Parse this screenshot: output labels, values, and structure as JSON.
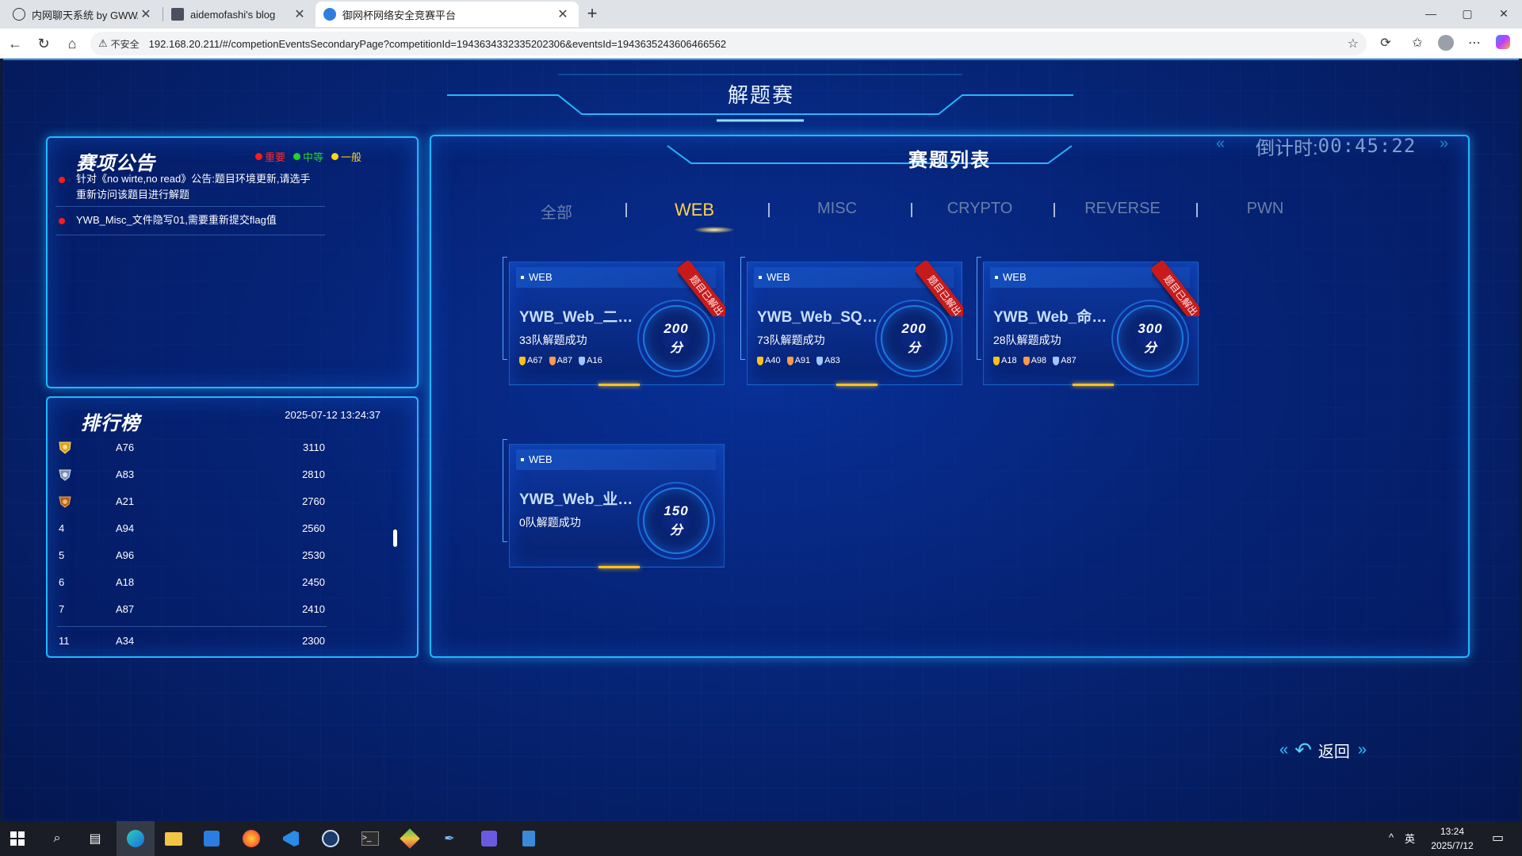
{
  "browser": {
    "tabs": [
      {
        "label": "内网聊天系统 by GWWAFZ",
        "close": "✕"
      },
      {
        "label": "aidemofashi's blog",
        "close": "✕"
      },
      {
        "label": "御网杯网络安全竞赛平台",
        "close": "✕"
      }
    ],
    "new_tab": "+",
    "insecure_label": "不安全",
    "url": "192.168.20.211/#/competionEventsSecondaryPage?competitionId=1943634332335202306&eventsId=1943635243606466562",
    "window": {
      "minimize": "—",
      "maximize": "▢",
      "close": "✕"
    }
  },
  "page": {
    "title": "解题赛",
    "countdown": {
      "label": "倒计时:",
      "value": "00:45:22"
    }
  },
  "notice_panel": {
    "title": "赛项公告",
    "legend": [
      {
        "label": "重要",
        "color": "#ff1a1a"
      },
      {
        "label": "中等",
        "color": "#22d42b"
      },
      {
        "label": "一般",
        "color": "#ffd21a"
      }
    ],
    "items": [
      {
        "text": "针对《no wirte,no read》公告:题目环境更新,请选手重新访问该题目进行解题"
      },
      {
        "text": "YWB_Misc_文件隐写01,需要重新提交flag值"
      }
    ]
  },
  "rank_panel": {
    "title": "排行榜",
    "time": "2025-07-12 13:24:37",
    "rows": [
      {
        "no": "",
        "medal": "gold",
        "team": "A76",
        "score": "3110"
      },
      {
        "no": "",
        "medal": "silver",
        "team": "A83",
        "score": "2810"
      },
      {
        "no": "",
        "medal": "bronze",
        "team": "A21",
        "score": "2760"
      },
      {
        "no": "4",
        "team": "A94",
        "score": "2560"
      },
      {
        "no": "5",
        "team": "A96",
        "score": "2530"
      },
      {
        "no": "6",
        "team": "A18",
        "score": "2450"
      },
      {
        "no": "7",
        "team": "A87",
        "score": "2410"
      },
      {
        "no": "11",
        "team": "A34",
        "score": "2300"
      }
    ]
  },
  "challenge_panel": {
    "title": "赛题列表",
    "tabs": [
      "全部",
      "WEB",
      "MISC",
      "CRYPTO",
      "REVERSE",
      "PWN"
    ],
    "active_tab": "WEB",
    "solved_ribbon": "题目已解出",
    "cards": [
      {
        "category": "WEB",
        "name": "YWB_Web_二次编码",
        "solved": "33队解题成功",
        "score": "200",
        "unit": "分",
        "solved_by_me": true,
        "medals": [
          {
            "team": "A67",
            "color": "#ffc21a"
          },
          {
            "team": "A87",
            "color": "#ff9a4a"
          },
          {
            "team": "A16",
            "color": "#9fc6ff"
          }
        ]
      },
      {
        "category": "WEB",
        "name": "YWB_Web_SQL注...",
        "solved": "73队解题成功",
        "score": "200",
        "unit": "分",
        "solved_by_me": true,
        "medals": [
          {
            "team": "A40",
            "color": "#ffc21a"
          },
          {
            "team": "A91",
            "color": "#ff9a4a"
          },
          {
            "team": "A83",
            "color": "#9fc6ff"
          }
        ]
      },
      {
        "category": "WEB",
        "name": "YWB_Web_命令执...",
        "solved": "28队解题成功",
        "score": "300",
        "unit": "分",
        "solved_by_me": true,
        "medals": [
          {
            "team": "A18",
            "color": "#ffc21a"
          },
          {
            "team": "A98",
            "color": "#ff9a4a"
          },
          {
            "team": "A87",
            "color": "#9fc6ff"
          }
        ]
      },
      {
        "category": "WEB",
        "name": "YWB_Web_业务逻...",
        "solved": "0队解题成功",
        "score": "150",
        "unit": "分",
        "solved_by_me": false,
        "medals": []
      }
    ],
    "back_label": "返回"
  },
  "taskbar": {
    "tray_ime": "英",
    "time": "13:24",
    "date": "2025/7/12"
  }
}
